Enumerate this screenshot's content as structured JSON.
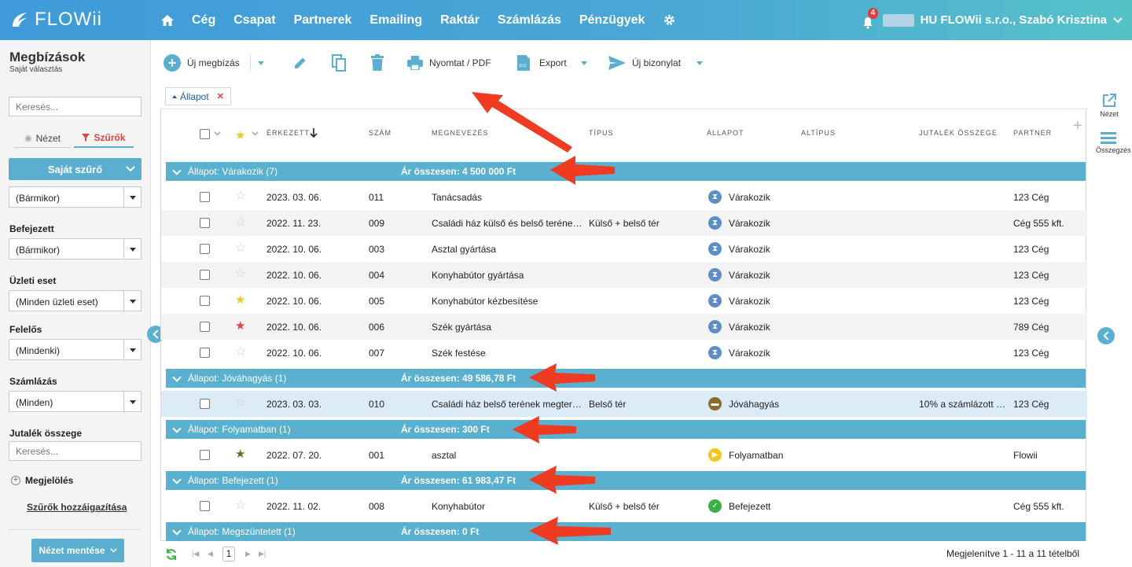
{
  "brand": {
    "name": "FLOWii",
    "colors": {
      "accent": "#5ab0cf",
      "topbar_start": "#3f9ad9",
      "topbar_end": "#56c2c8",
      "arrow": "#ee3b22"
    }
  },
  "nav": {
    "home_icon": "home-icon",
    "items": [
      "Cég",
      "Csapat",
      "Partnerek",
      "Emailing",
      "Raktár",
      "Számlázás",
      "Pénzügyek"
    ],
    "settings_icon": "gear-icon"
  },
  "user": {
    "notification_count": "4",
    "name": "HU FLOWii s.r.o., Szabó Krisztina"
  },
  "page": {
    "title": "Megbízások",
    "subtitle": "Saját választás"
  },
  "sidebar": {
    "search_placeholder": "Keresés...",
    "tab_view": "Nézet",
    "tab_filters": "Szűrők",
    "own_filter": "Saját szűrő",
    "first_select": "(Bármikor)",
    "filters": [
      {
        "label": "Befejezett",
        "value": "(Bármikor)"
      },
      {
        "label": "Üzleti eset",
        "value": "(Minden üzleti eset)"
      },
      {
        "label": "Felelős",
        "value": "(Mindenki)"
      },
      {
        "label": "Számlázás",
        "value": "(Minden)"
      }
    ],
    "commission_label": "Jutalék összege",
    "commission_placeholder": "Keresés...",
    "marking": "Megjelölés",
    "assign_filters": "Szűrők hozzáigazítása",
    "save_view": "Nézet mentése"
  },
  "toolbar": {
    "new": "Új megbízás",
    "print": "Nyomtat / PDF",
    "export": "Export",
    "new_doc": "Új bizonylat"
  },
  "filter_tag": {
    "label": "Állapot"
  },
  "columns": [
    "ÉRKEZETT",
    "SZÁM",
    "MEGNEVEZÉS",
    "TÍPUS",
    "ÁLLAPOT",
    "ALTÍPUS",
    "JUTALÉK ÖSSZEGE",
    "PARTNER"
  ],
  "groups": [
    {
      "title": "Állapot: Várakozik (7)",
      "sum": "Ár összesen: 4 500 000 Ft",
      "rows": [
        {
          "date": "2023. 03. 06.",
          "num": "011",
          "name": "Tanácsadás",
          "type": "",
          "status": "Várakozik",
          "status_kind": "waiting",
          "commission": "",
          "partner": "123 Cég",
          "star": "none"
        },
        {
          "date": "2022. 11. 23.",
          "num": "009",
          "name": "Családi ház külső és belső teréne…",
          "type": "Külső + belső tér",
          "status": "Várakozik",
          "status_kind": "waiting",
          "commission": "",
          "partner": "Cég 555 kft.",
          "star": "none"
        },
        {
          "date": "2022. 10. 06.",
          "num": "003",
          "name": "Asztal gyártása",
          "type": "",
          "status": "Várakozik",
          "status_kind": "waiting",
          "commission": "",
          "partner": "123 Cég",
          "star": "none"
        },
        {
          "date": "2022. 10. 06.",
          "num": "004",
          "name": "Konyhabútor gyártása",
          "type": "",
          "status": "Várakozik",
          "status_kind": "waiting",
          "commission": "",
          "partner": "123 Cég",
          "star": "none"
        },
        {
          "date": "2022. 10. 06.",
          "num": "005",
          "name": "Konyhabútor kézbesítése",
          "type": "",
          "status": "Várakozik",
          "status_kind": "waiting",
          "commission": "",
          "partner": "123 Cég",
          "star": "yellow"
        },
        {
          "date": "2022. 10. 06.",
          "num": "006",
          "name": "Szék gyártása",
          "type": "",
          "status": "Várakozik",
          "status_kind": "waiting",
          "commission": "",
          "partner": "789 Cég",
          "star": "red"
        },
        {
          "date": "2022. 10. 06.",
          "num": "007",
          "name": "Szék festése",
          "type": "",
          "status": "Várakozik",
          "status_kind": "waiting",
          "commission": "",
          "partner": "123 Cég",
          "star": "none"
        }
      ]
    },
    {
      "title": "Állapot: Jóváhagyás (1)",
      "sum": "Ár összesen: 49 586,78 Ft",
      "rows": [
        {
          "date": "2023. 03. 03.",
          "num": "010",
          "name": "Családi ház belső terének megter…",
          "type": "Belső tér",
          "status": "Jóváhagyás",
          "status_kind": "approval",
          "commission": "10% a számlázott …",
          "partner": "123 Cég",
          "star": "none"
        }
      ]
    },
    {
      "title": "Állapot: Folyamatban (1)",
      "sum": "Ár összesen: 300 Ft",
      "rows": [
        {
          "date": "2022. 07. 20.",
          "num": "001",
          "name": "asztal",
          "type": "",
          "status": "Folyamatban",
          "status_kind": "progress",
          "commission": "",
          "partner": "Flowii",
          "star": "olive"
        }
      ]
    },
    {
      "title": "Állapot: Befejezett (1)",
      "sum": "Ár összesen: 61 983,47 Ft",
      "rows": [
        {
          "date": "2022. 11. 02.",
          "num": "008",
          "name": "Konyhabútor",
          "type": "Külső + belső tér",
          "status": "Befejezett",
          "status_kind": "done",
          "commission": "",
          "partner": "Cég 555 kft.",
          "star": "none"
        }
      ]
    },
    {
      "title": "Állapot: Megszüntetett (1)",
      "sum": "Ár összesen: 0 Ft",
      "rows": []
    }
  ],
  "footer": {
    "page": "1",
    "summary": "Megjelenítve 1 - 11 a 11 tételből"
  },
  "rightrail": {
    "view": "Nézet",
    "summary": "Összegzés"
  }
}
